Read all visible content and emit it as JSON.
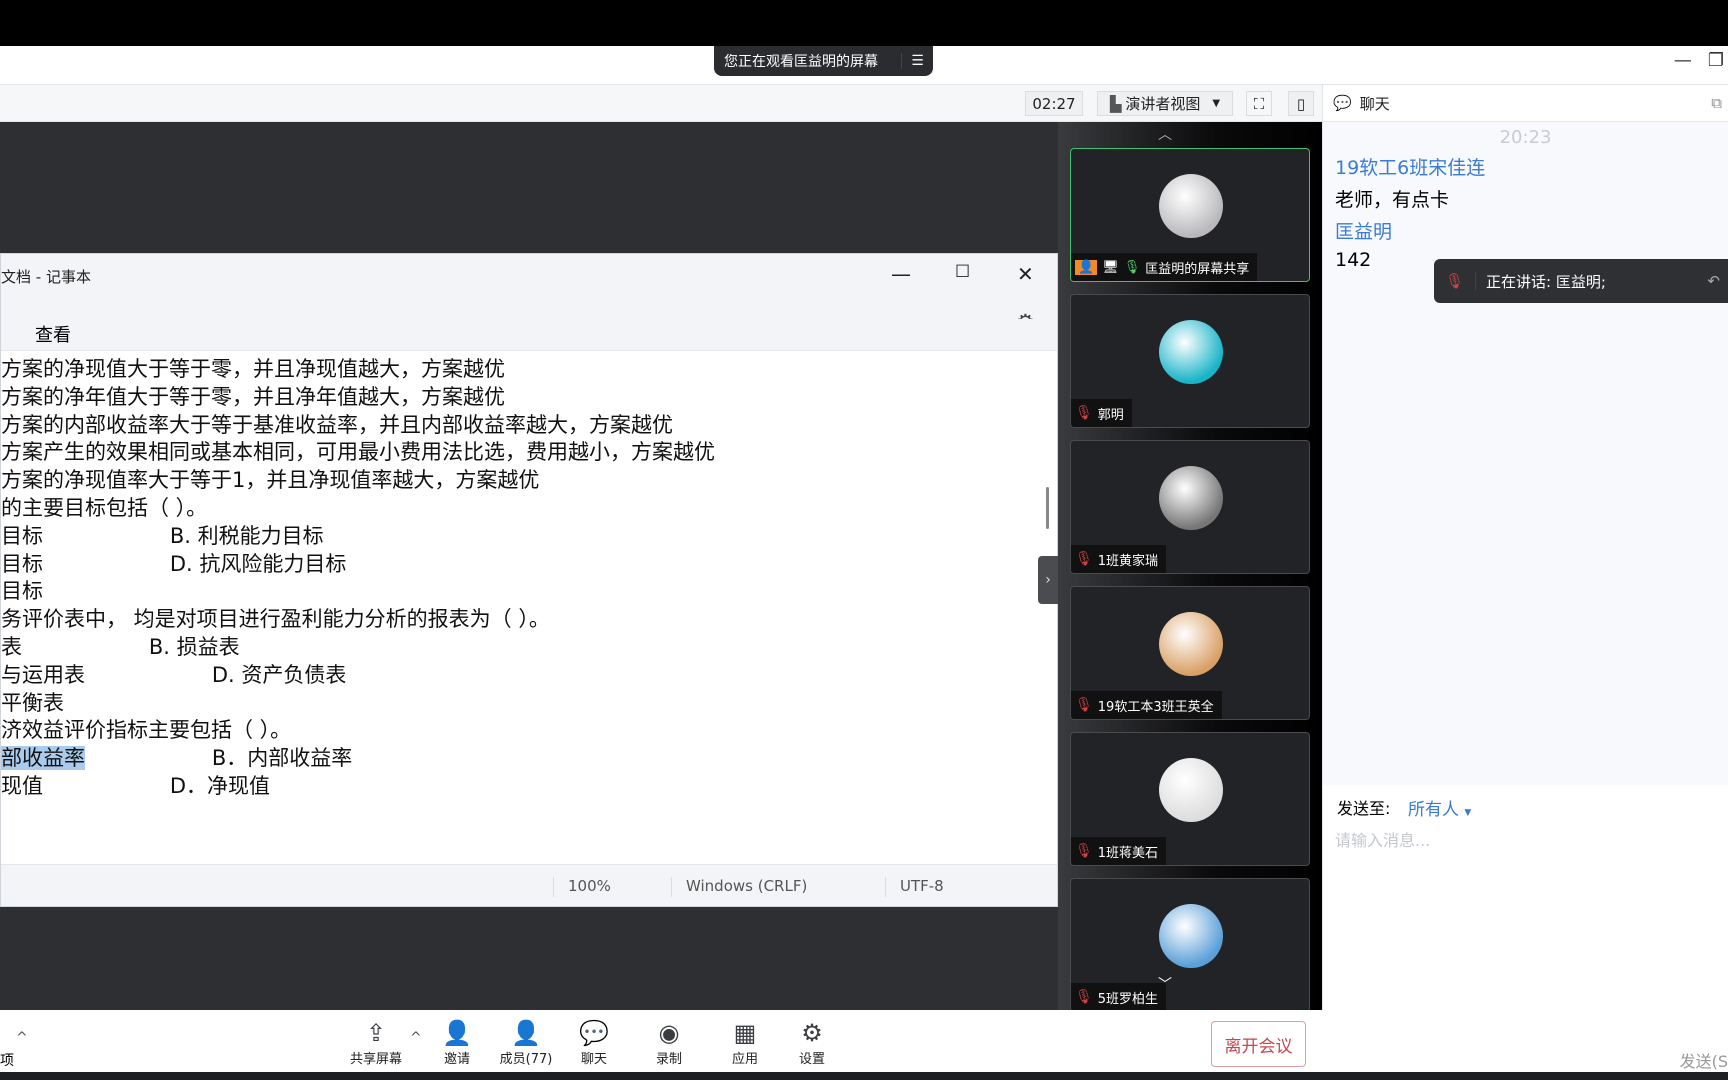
{
  "banner": {
    "text": "您正在观看匡益明的屏幕",
    "menu_icon": "menu-icon"
  },
  "toolbar": {
    "timer": "02:27",
    "view_mode": "演讲者视图"
  },
  "notepad": {
    "title": "文档 - 记事本",
    "menu": [
      "查看"
    ],
    "lines": [
      {
        "t": "方案的净现值大于等于零，并且净现值越大，方案越优"
      },
      {
        "t": "方案的净年值大于等于零，并且净年值越大，方案越优"
      },
      {
        "t": "方案的内部收益率大于等于基准收益率，并且内部收益率越大，方案越优"
      },
      {
        "t": "方案产生的效果相同或基本相同，可用最小费用法比选，费用越小，方案越优"
      },
      {
        "t": "方案的净现值率大于等于1，并且净现值率越大，方案越优"
      },
      {
        "t": "的主要目标包括（ ）。"
      },
      {
        "t": "目标                   B. 利税能力目标"
      },
      {
        "t": "目标                   D. 抗风险能力目标"
      },
      {
        "t": "目标"
      },
      {
        "t": "务评价表中， 均是对项目进行盈利能力分析的报表为（ ）。"
      },
      {
        "t": "表                   B. 损益表"
      },
      {
        "t": "与运用表                   D. 资产负债表"
      },
      {
        "t": "平衡表"
      },
      {
        "t": "济效益评价指标主要包括（ ）。"
      },
      {
        "sel": "部收益率",
        "t": "                   B．内部收益率"
      },
      {
        "t": "现值                   D．净现值"
      }
    ],
    "status": {
      "zoom": "100%",
      "line_ending": "Windows (CRLF)",
      "encoding": "UTF-8"
    }
  },
  "participants": [
    {
      "name": "匡益明的屏幕共享",
      "muted": false,
      "active": true,
      "avatar": "#b9b9bd"
    },
    {
      "name": "郭明",
      "muted": true,
      "avatar": "#19b4c8"
    },
    {
      "name": "1班黄家瑞",
      "muted": true,
      "avatar": "#777"
    },
    {
      "name": "19软工本3班王英全",
      "muted": true,
      "avatar": "#d9a066"
    },
    {
      "name": "1班蒋美石",
      "muted": true,
      "avatar": "#ddd"
    },
    {
      "name": "5班罗柏生",
      "muted": true,
      "avatar": "#5a9fd8"
    }
  ],
  "chat": {
    "header": "聊天",
    "timestamp": "20:23",
    "messages": [
      {
        "sender": "19软工6班宋佳连",
        "text": "老师，有点卡"
      },
      {
        "sender": "匡益明",
        "text": "142"
      }
    ],
    "speaking": "正在讲话: 匡益明;",
    "send_to_label": "发送至:",
    "send_to_value": "所有人",
    "placeholder": "请输入消息...",
    "send": "发送(S"
  },
  "bottombar": {
    "left_fragment": "项",
    "buttons": [
      {
        "label": "共享屏幕",
        "icon": "share-screen-icon",
        "g": "⇪"
      },
      {
        "label": "邀请",
        "icon": "invite-icon",
        "g": "👤"
      },
      {
        "label": "成员(77)",
        "icon": "members-icon",
        "g": "👤"
      },
      {
        "label": "聊天",
        "icon": "chat-icon",
        "g": "💬"
      },
      {
        "label": "录制",
        "icon": "record-icon",
        "g": "◉"
      },
      {
        "label": "应用",
        "icon": "apps-icon",
        "g": "▦"
      },
      {
        "label": "设置",
        "icon": "settings-icon",
        "g": "⚙"
      }
    ],
    "leave": "离开会议"
  },
  "colors": {
    "accent": "#3a7bd5",
    "leave": "#c5464f",
    "active_border": "#3fbf74"
  }
}
